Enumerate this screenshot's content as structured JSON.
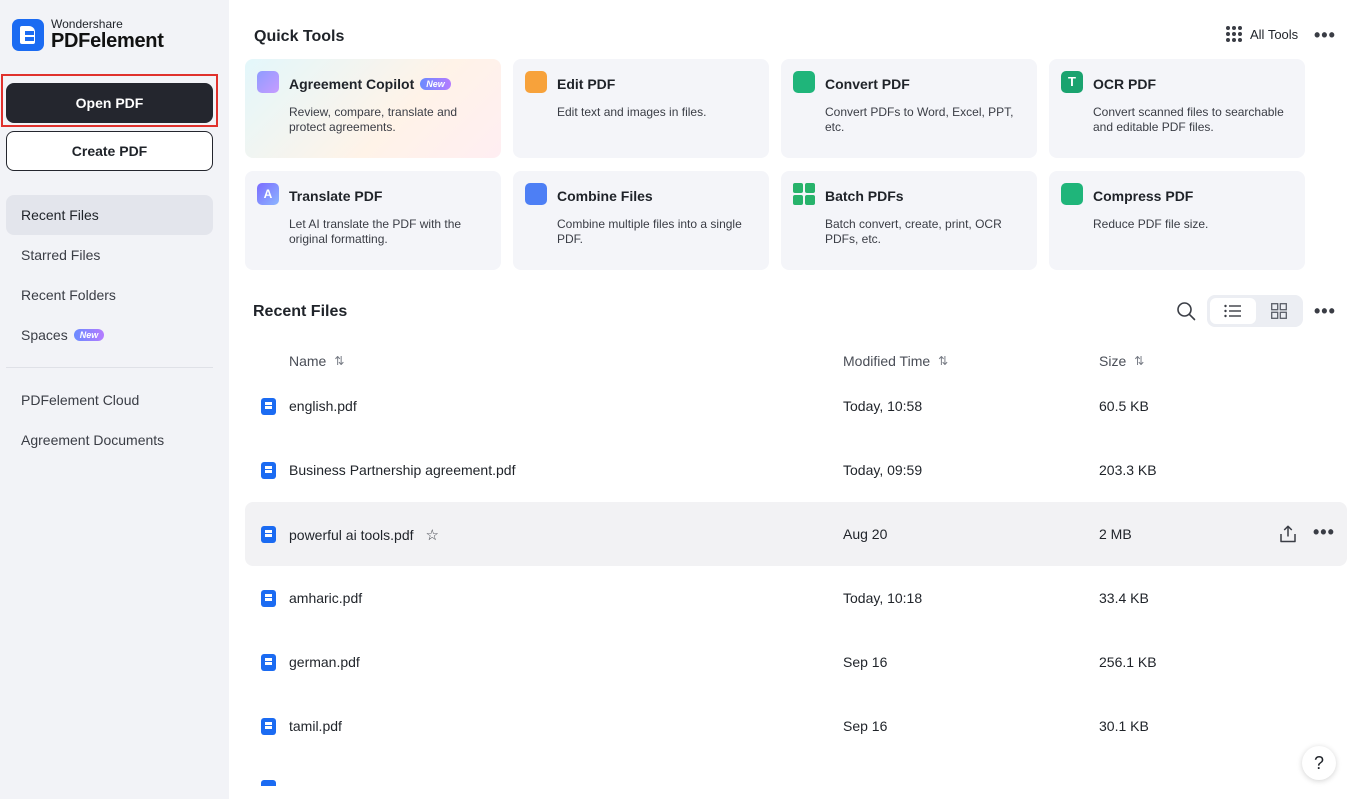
{
  "app": {
    "brand_small": "Wondershare",
    "brand_name": "PDFelement",
    "accent_color": "#1b6bf2"
  },
  "sidebar": {
    "open_pdf": "Open PDF",
    "create_pdf": "Create PDF",
    "items": [
      {
        "label": "Recent Files",
        "active": true
      },
      {
        "label": "Starred Files"
      },
      {
        "label": "Recent Folders"
      },
      {
        "label": "Spaces",
        "badge": "New"
      },
      {
        "label": "PDFelement Cloud"
      },
      {
        "label": "Agreement Documents"
      }
    ]
  },
  "quick_tools": {
    "title": "Quick Tools",
    "all_tools": "All Tools",
    "tools": [
      {
        "name": "Agreement Copilot",
        "badge": "New",
        "desc": "Review, compare, translate and protect agreements.",
        "icon": "copilot-icon"
      },
      {
        "name": "Edit PDF",
        "desc": "Edit text and images in files.",
        "icon": "edit-pdf-icon"
      },
      {
        "name": "Convert PDF",
        "desc": "Convert PDFs to Word, Excel, PPT, etc.",
        "icon": "convert-pdf-icon"
      },
      {
        "name": "OCR PDF",
        "desc": "Convert scanned files to searchable and editable PDF files.",
        "icon": "ocr-pdf-icon"
      },
      {
        "name": "Translate PDF",
        "desc": "Let AI translate the PDF with the original formatting.",
        "icon": "translate-pdf-icon"
      },
      {
        "name": "Combine Files",
        "desc": "Combine multiple files into a single PDF.",
        "icon": "combine-files-icon"
      },
      {
        "name": "Batch PDFs",
        "desc": "Batch convert, create, print, OCR PDFs, etc.",
        "icon": "batch-pdfs-icon"
      },
      {
        "name": "Compress PDF",
        "desc": "Reduce PDF file size.",
        "icon": "compress-pdf-icon"
      }
    ]
  },
  "recent_files": {
    "title": "Recent Files",
    "columns": {
      "name": "Name",
      "modified": "Modified Time",
      "size": "Size"
    },
    "files": [
      {
        "name": "english.pdf",
        "modified": "Today, 10:58",
        "size": "60.5 KB"
      },
      {
        "name": "Business Partnership agreement.pdf",
        "modified": "Today, 09:59",
        "size": "203.3 KB"
      },
      {
        "name": "powerful ai tools.pdf",
        "modified": "Aug 20",
        "size": "2 MB",
        "hovered": true
      },
      {
        "name": "amharic.pdf",
        "modified": "Today, 10:18",
        "size": "33.4 KB"
      },
      {
        "name": "german.pdf",
        "modified": "Sep 16",
        "size": "256.1 KB"
      },
      {
        "name": "tamil.pdf",
        "modified": "Sep 16",
        "size": "30.1 KB"
      }
    ]
  },
  "help": {
    "label": "?"
  }
}
